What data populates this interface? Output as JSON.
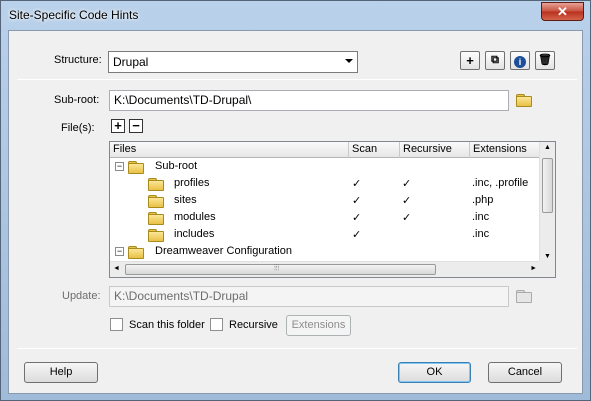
{
  "window": {
    "title": "Site-Specific Code Hints",
    "close_glyph": "✕"
  },
  "structure": {
    "label": "Structure:",
    "value": "Drupal",
    "buttons": [
      "+",
      "⧉",
      "i",
      "🗑"
    ]
  },
  "subroot": {
    "label": "Sub-root:",
    "value": "K:\\Documents\\TD-Drupal\\"
  },
  "files": {
    "label": "File(s):",
    "add": "+",
    "remove": "−",
    "columns": [
      "Files",
      "Scan",
      "Recursive",
      "Extensions"
    ],
    "rows": [
      {
        "name": "Sub-root",
        "expander": "−",
        "scan": "",
        "recursive": "",
        "ext": ""
      },
      {
        "name": "profiles",
        "scan": "✓",
        "recursive": "✓",
        "ext": ".inc, .profile"
      },
      {
        "name": "sites",
        "scan": "✓",
        "recursive": "✓",
        "ext": ".php"
      },
      {
        "name": "modules",
        "scan": "✓",
        "recursive": "✓",
        "ext": ".inc"
      },
      {
        "name": "includes",
        "scan": "✓",
        "recursive": "",
        "ext": ".inc"
      },
      {
        "name": "Dreamweaver Configuration",
        "expander": "−",
        "scan": "",
        "recursive": "",
        "ext": ""
      }
    ],
    "scroll": {
      "up": "▲",
      "down": "▼",
      "left": "◄",
      "right": "►",
      "grip": "⦙⦙⦙"
    }
  },
  "update": {
    "label": "Update:",
    "value": "K:\\Documents\\TD-Drupal"
  },
  "options": {
    "scan_label": "Scan this folder",
    "recursive_label": "Recursive",
    "extensions_label": "Extensions"
  },
  "footer": {
    "help": "Help",
    "ok": "OK",
    "cancel": "Cancel"
  }
}
